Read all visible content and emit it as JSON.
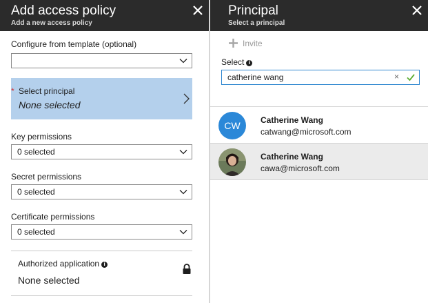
{
  "left_blade": {
    "title": "Add access policy",
    "subtitle": "Add a new access policy",
    "template": {
      "label": "Configure from template (optional)",
      "value": ""
    },
    "principal": {
      "required_mark": "*",
      "label": "Select principal",
      "value": "None selected"
    },
    "key_permissions": {
      "label": "Key permissions",
      "value": "0 selected"
    },
    "secret_permissions": {
      "label": "Secret permissions",
      "value": "0 selected"
    },
    "certificate_permissions": {
      "label": "Certificate permissions",
      "value": "0 selected"
    },
    "authorized_application": {
      "label": "Authorized application",
      "info": "i",
      "value": "None selected"
    }
  },
  "right_blade": {
    "title": "Principal",
    "subtitle": "Select a principal",
    "invite_label": "Invite",
    "select_label": "Select",
    "select_info": "i",
    "search_value": "catherine wang",
    "clear_label": "×",
    "results": [
      {
        "initials": "CW",
        "name": "Catherine Wang",
        "email": "catwang@microsoft.com",
        "avatar": "initials"
      },
      {
        "initials": "",
        "name": "Catherine Wang",
        "email": "cawa@microsoft.com",
        "avatar": "photo"
      }
    ]
  },
  "colors": {
    "header_bg": "#2b2b2b",
    "selection_highlight": "#b4d0ec",
    "required_star": "#d13438",
    "avatar_bg": "#2b88d8",
    "search_border": "#2f87d0",
    "check_green": "#5cad31",
    "selected_row": "#ebebeb"
  }
}
